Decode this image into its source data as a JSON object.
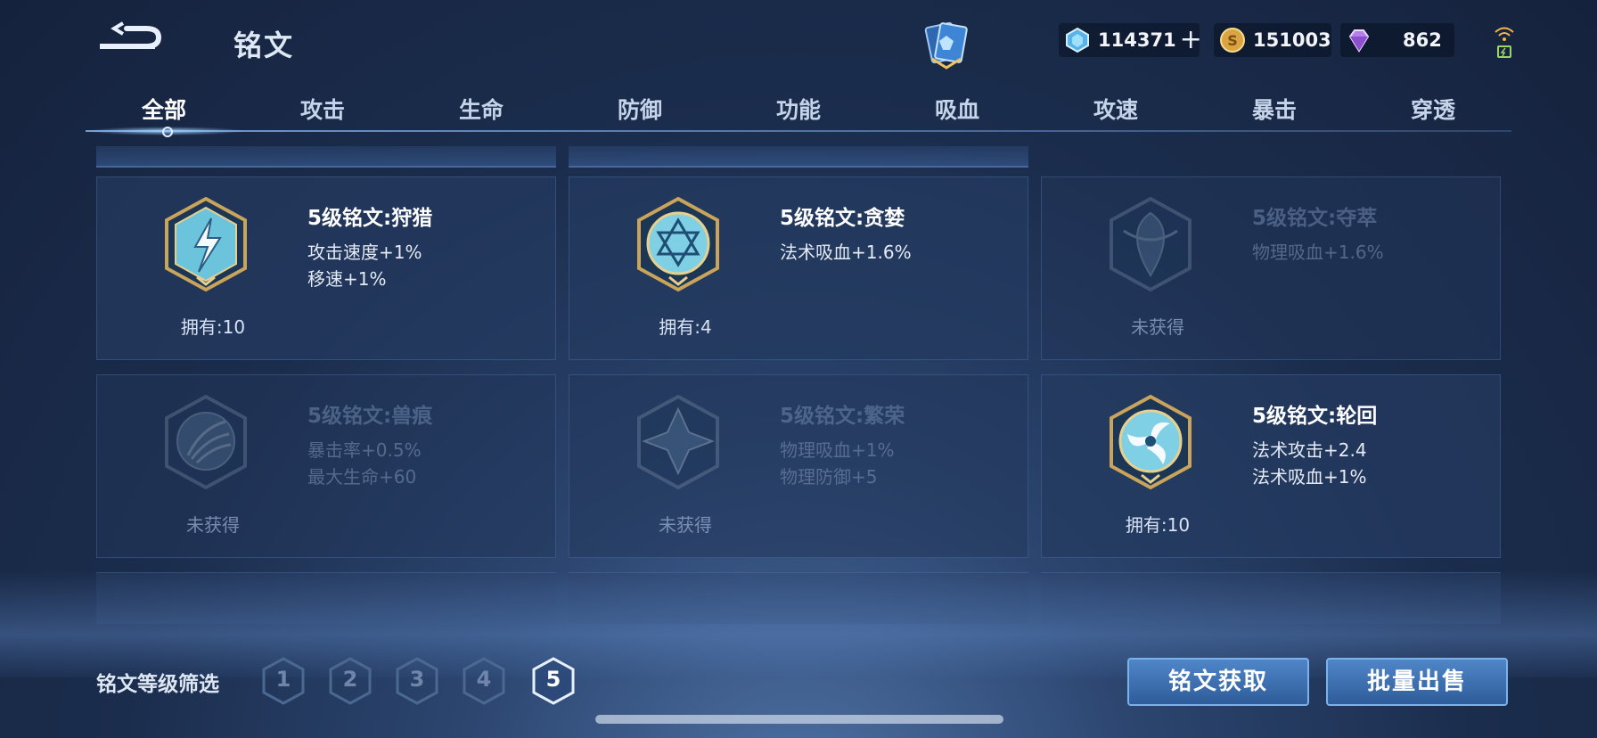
{
  "header": {
    "title": "铭文",
    "currencies": [
      {
        "name": "gem",
        "value": "114371",
        "has_plus": true
      },
      {
        "name": "gold",
        "value": "151003"
      },
      {
        "name": "diamond",
        "value": "862"
      }
    ]
  },
  "tabs": [
    {
      "label": "全部",
      "active": true
    },
    {
      "label": "攻击"
    },
    {
      "label": "生命"
    },
    {
      "label": "防御"
    },
    {
      "label": "功能"
    },
    {
      "label": "吸血"
    },
    {
      "label": "攻速"
    },
    {
      "label": "暴击"
    },
    {
      "label": "穿透"
    }
  ],
  "runes": [
    {
      "name": "5级铭文:狩猎",
      "stats": [
        "攻击速度+1%",
        "移速+1%"
      ],
      "owned": "拥有:10",
      "locked": false
    },
    {
      "name": "5级铭文:贪婪",
      "stats": [
        "法术吸血+1.6%",
        ""
      ],
      "owned": "拥有:4",
      "locked": false
    },
    {
      "name": "5级铭文:夺萃",
      "stats": [
        "物理吸血+1.6%",
        ""
      ],
      "owned": "未获得",
      "locked": true
    },
    {
      "name": "5级铭文:兽痕",
      "stats": [
        "暴击率+0.5%",
        "最大生命+60"
      ],
      "owned": "未获得",
      "locked": true
    },
    {
      "name": "5级铭文:繁荣",
      "stats": [
        "物理吸血+1%",
        "物理防御+5"
      ],
      "owned": "未获得",
      "locked": true
    },
    {
      "name": "5级铭文:轮回",
      "stats": [
        "法术攻击+2.4",
        "法术吸血+1%"
      ],
      "owned": "拥有:10",
      "locked": false
    }
  ],
  "filter": {
    "label": "铭文等级筛选",
    "levels": [
      "1",
      "2",
      "3",
      "4",
      "5"
    ],
    "selected": "5"
  },
  "buttons": {
    "acquire": "铭文获取",
    "bulk_sell": "批量出售"
  },
  "colors": {
    "accent": "#4f86c8",
    "gold_frame": "#c9a45a",
    "rune_teal": "#8fd3e6"
  }
}
